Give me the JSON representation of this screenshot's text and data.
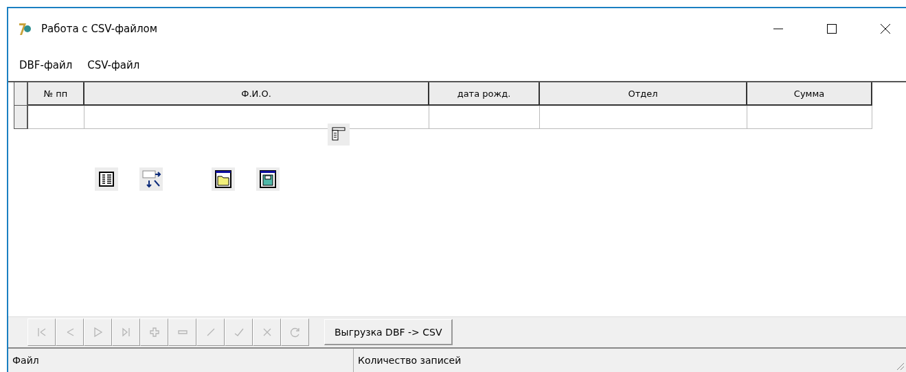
{
  "window": {
    "title": "Работа с CSV-файлом"
  },
  "menu": [
    "DBF-файл",
    "CSV-файл"
  ],
  "table": {
    "columns": [
      "№ пп",
      "Ф.И.О.",
      "дата рожд.",
      "Отдел",
      "Сумма"
    ]
  },
  "navigator": [
    {
      "kind": "first",
      "disabled": true
    },
    {
      "kind": "prior",
      "disabled": true
    },
    {
      "kind": "next",
      "disabled": true
    },
    {
      "kind": "last",
      "disabled": true
    },
    {
      "kind": "insert",
      "disabled": true
    },
    {
      "kind": "delete",
      "disabled": true
    },
    {
      "kind": "edit",
      "disabled": true
    },
    {
      "kind": "post",
      "disabled": true
    },
    {
      "kind": "cancel",
      "disabled": true
    },
    {
      "kind": "refresh",
      "disabled": true
    }
  ],
  "export_button": "Выгрузка DBF -> CSV",
  "status_bar": [
    "Файл",
    "Количество записей"
  ]
}
